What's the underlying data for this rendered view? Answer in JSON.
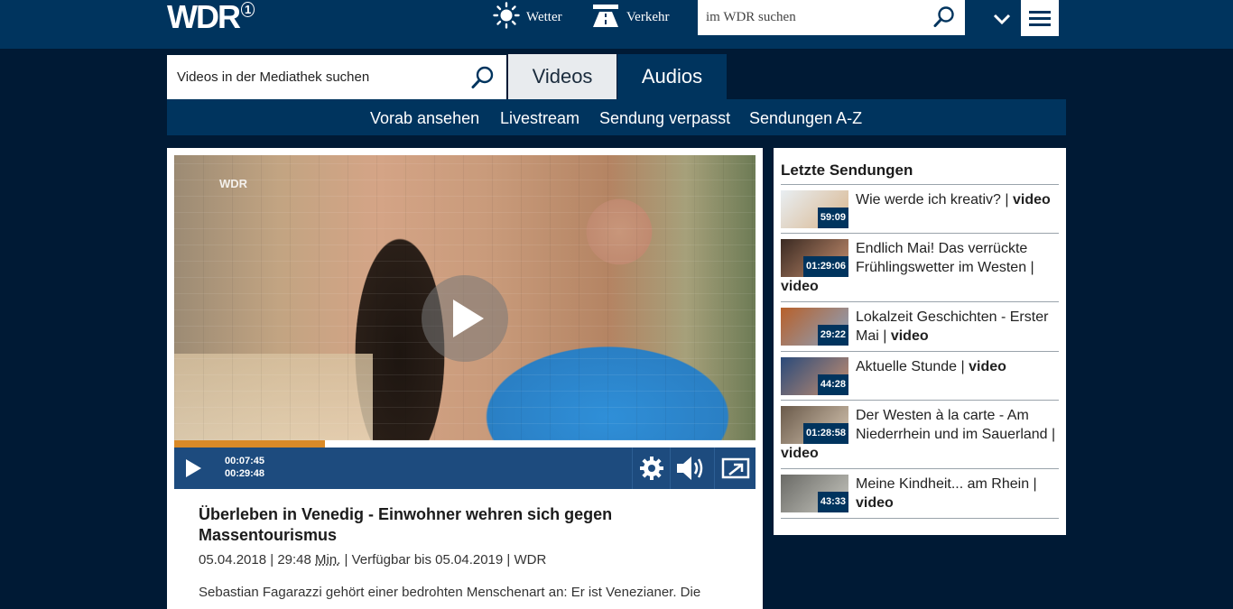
{
  "header": {
    "logo": "WDR",
    "logo_sup": "1",
    "wetter": "Wetter",
    "verkehr": "Verkehr",
    "search_placeholder": "im WDR suchen"
  },
  "mediathek": {
    "search_placeholder": "Videos in der Mediathek suchen",
    "tabs": [
      "Videos",
      "Audios"
    ],
    "subnav": [
      "Vorab ansehen",
      "Livestream",
      "Sendung verpasst",
      "Sendungen A-Z"
    ]
  },
  "player": {
    "current_time": "00:07:45",
    "total_time": "00:29:48",
    "progress_fraction": 0.26,
    "bug": "WDR"
  },
  "article": {
    "title": "Überleben in Venedig - Einwohner wehren sich gegen Massentourismus",
    "date": "05.04.2018",
    "duration": "29:48",
    "duration_unit": "Min.",
    "availability": "Verfügbar bis 05.04.2019",
    "channel": "WDR",
    "description": "Sebastian Fagarazzi gehört einer bedrohten Menschenart an: Er ist Venezianer. Die"
  },
  "sidebar": {
    "title": "Letzte Sendungen",
    "items": [
      {
        "title": "Wie werde ich kreativ? | ",
        "kind": "video",
        "duration": "59:09",
        "colors": [
          "#e8eef2",
          "#d9b58c"
        ]
      },
      {
        "title": "Endlich Mai! Das verrückte Frühlingswetter im Westen | ",
        "kind": "video",
        "duration": "01:29:06",
        "colors": [
          "#3a2a22",
          "#c89070"
        ]
      },
      {
        "title": "Lokalzeit Geschichten - Erster Mai | ",
        "kind": "video",
        "duration": "29:22",
        "colors": [
          "#b8602a",
          "#8aa4c2"
        ]
      },
      {
        "title": "Aktuelle Stunde | ",
        "kind": "video",
        "duration": "44:28",
        "colors": [
          "#2a4a7a",
          "#c89070"
        ]
      },
      {
        "title": "Der Westen à la carte - Am Niederrhein und im Sauerland | ",
        "kind": "video",
        "duration": "01:28:58",
        "colors": [
          "#6a5a4a",
          "#d8c8b4"
        ]
      },
      {
        "title": "Meine Kindheit... am Rhein | ",
        "kind": "video",
        "duration": "43:33",
        "colors": [
          "#6a6a66",
          "#c8c8c0"
        ]
      }
    ]
  },
  "colors": {
    "brand_dark": "#00345e",
    "page_bg": "#001a35",
    "progress": "#d98a28",
    "controls": "#1d4b7e"
  }
}
